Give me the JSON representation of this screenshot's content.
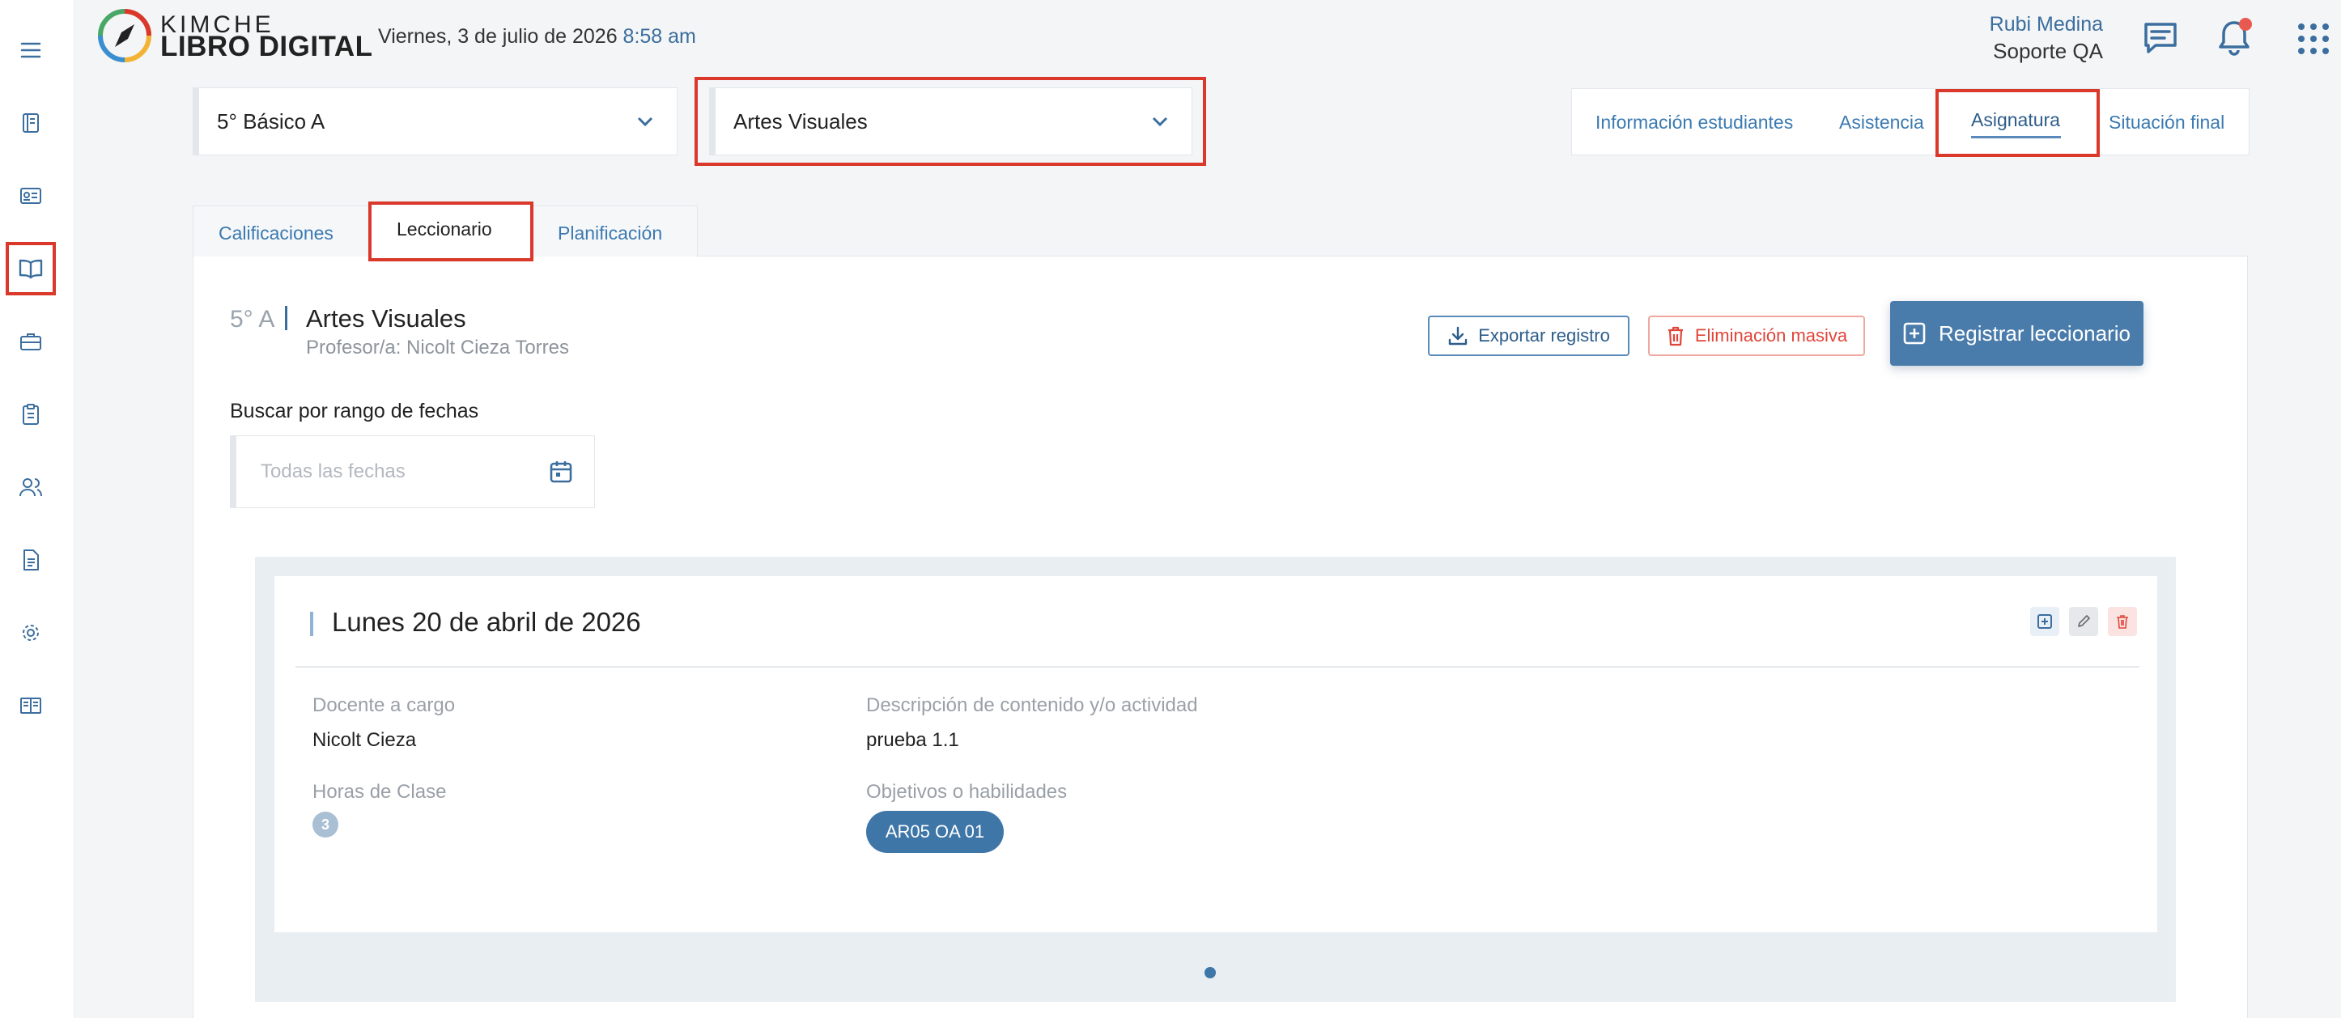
{
  "header": {
    "logo_top": "KIMCHE",
    "logo_bottom": "LIBRO DIGITAL",
    "date": "Viernes, 3 de julio de 2026",
    "time": "8:58 am",
    "user_name": "Rubi Medina",
    "user_role": "Soporte QA"
  },
  "sidebar": {
    "items": [
      {
        "icon": "menu-icon"
      },
      {
        "icon": "notebook-icon"
      },
      {
        "icon": "id-card-icon"
      },
      {
        "icon": "open-book-icon",
        "highlighted": true
      },
      {
        "icon": "briefcase-icon"
      },
      {
        "icon": "clipboard-icon"
      },
      {
        "icon": "users-icon"
      },
      {
        "icon": "document-icon"
      },
      {
        "icon": "gear-icon"
      },
      {
        "icon": "book-icon"
      }
    ]
  },
  "filters": {
    "course_select": "5° Básico A",
    "subject_select": "Artes Visuales"
  },
  "top_nav": {
    "items": [
      "Información estudiantes",
      "Asistencia",
      "Asignatura",
      "Situación final"
    ],
    "active": "Asignatura"
  },
  "tabs": {
    "items": [
      "Calificaciones",
      "Leccionario",
      "Planificación"
    ],
    "active": "Leccionario"
  },
  "course": {
    "code": "5° A",
    "name": "Artes Visuales",
    "teacher": "Profesor/a: Nicolt Cieza Torres"
  },
  "actions": {
    "export": "Exportar registro",
    "bulk_delete": "Eliminación masiva",
    "register": "Registrar leccionario"
  },
  "search": {
    "label": "Buscar por rango de fechas",
    "placeholder": "Todas las fechas"
  },
  "entry": {
    "date_title": "Lunes 20 de abril de 2026",
    "teacher_label": "Docente a cargo",
    "teacher_value": "Nicolt Cieza",
    "hours_label": "Horas de Clase",
    "hours_value": "3",
    "description_label": "Descripción de contenido y/o actividad",
    "description_value": "prueba 1.1",
    "objectives_label": "Objetivos o habilidades",
    "objectives": [
      "AR05 OA 01"
    ]
  },
  "colors": {
    "accent": "#3f76a8",
    "highlight": "#d9382b",
    "danger": "#e0453a"
  }
}
